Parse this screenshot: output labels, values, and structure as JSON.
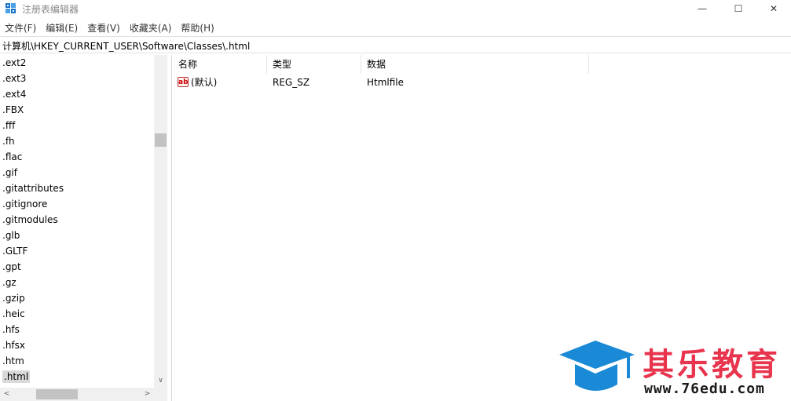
{
  "window": {
    "title": "注册表编辑器",
    "controls": {
      "minimize": "—",
      "maximize": "☐",
      "close": "✕"
    }
  },
  "menu": [
    "文件(F)",
    "编辑(E)",
    "查看(V)",
    "收藏夹(A)",
    "帮助(H)"
  ],
  "address": "计算机\\HKEY_CURRENT_USER\\Software\\Classes\\.html",
  "tree": {
    "items": [
      ".ext2",
      ".ext3",
      ".ext4",
      ".FBX",
      ".fff",
      ".fh",
      ".flac",
      ".gif",
      ".gitattributes",
      ".gitignore",
      ".gitmodules",
      ".glb",
      ".GLTF",
      ".gpt",
      ".gz",
      ".gzip",
      ".heic",
      ".hfs",
      ".hfsx",
      ".htm",
      ".html"
    ],
    "selected": ".html",
    "scroll_up": "∧",
    "scroll_down": "∨",
    "scroll_left": "<",
    "scroll_right": ">"
  },
  "list": {
    "columns": [
      "名称",
      "类型",
      "数据"
    ],
    "rows": [
      {
        "icon": "ab",
        "name": "(默认)",
        "type": "REG_SZ",
        "data": "Htmlfile"
      }
    ]
  },
  "watermark": {
    "brand": "其乐教育",
    "url": "www.76edu.com"
  },
  "colors": {
    "accent": "#1a8ad6",
    "brand": "#e8344d"
  }
}
